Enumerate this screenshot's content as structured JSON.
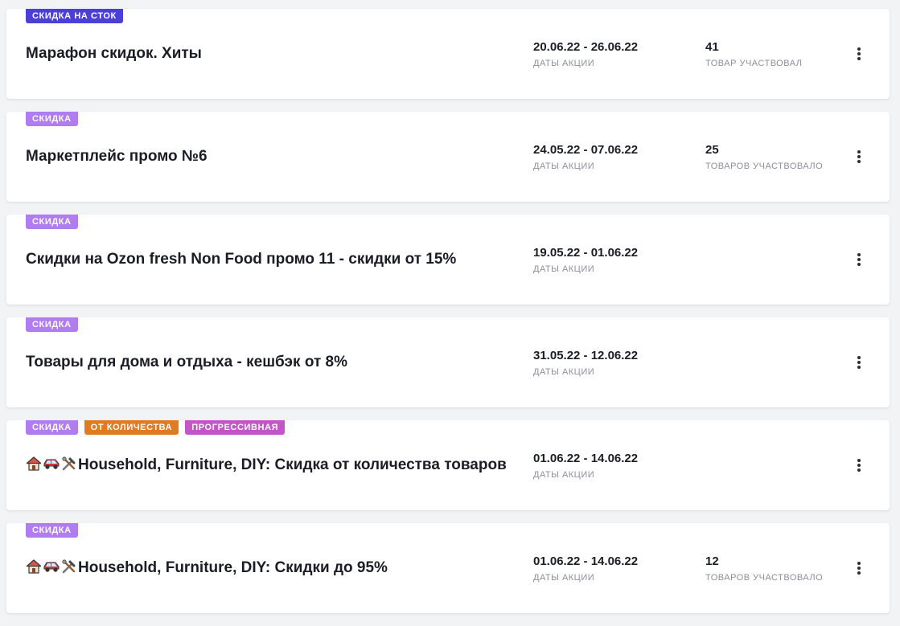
{
  "colors": {
    "stock_badge": "#4b3fd6",
    "discount_badge": "#b17cf0",
    "quantity_badge": "#e07b21",
    "progressive_badge": "#c355c9"
  },
  "promotions": [
    {
      "badges": [
        {
          "label": "СКИДКА НА СТОК",
          "type": "stock"
        }
      ],
      "icons": [],
      "title": "Марафон скидок. Хиты",
      "dates": "20.06.22 - 26.06.22",
      "dates_caption": "ДАТЫ АКЦИИ",
      "count": "41",
      "count_caption": "ТОВАР УЧАСТВОВАЛ"
    },
    {
      "badges": [
        {
          "label": "СКИДКА",
          "type": "discount"
        }
      ],
      "icons": [],
      "title": "Маркетплейс промо №6",
      "dates": "24.05.22 - 07.06.22",
      "dates_caption": "ДАТЫ АКЦИИ",
      "count": "25",
      "count_caption": "ТОВАРОВ УЧАСТВОВАЛО"
    },
    {
      "badges": [
        {
          "label": "СКИДКА",
          "type": "discount"
        }
      ],
      "icons": [],
      "title": "Скидки на Ozon fresh Non Food промо 11 - скидки от 15%",
      "dates": "19.05.22 - 01.06.22",
      "dates_caption": "ДАТЫ АКЦИИ",
      "count": "",
      "count_caption": ""
    },
    {
      "badges": [
        {
          "label": "СКИДКА",
          "type": "discount"
        }
      ],
      "icons": [],
      "title": "Товары для дома и отдыха - кешбэк от 8%",
      "dates": "31.05.22 - 12.06.22",
      "dates_caption": "ДАТЫ АКЦИИ",
      "count": "",
      "count_caption": ""
    },
    {
      "badges": [
        {
          "label": "СКИДКА",
          "type": "discount"
        },
        {
          "label": "ОТ КОЛИЧЕСТВА",
          "type": "quantity"
        },
        {
          "label": "ПРОГРЕССИВНАЯ",
          "type": "progressive"
        }
      ],
      "icons": [
        "house-icon",
        "car-icon",
        "tools-icon"
      ],
      "title": "Household, Furniture, DIY: Скидка от количества товаров",
      "dates": "01.06.22 - 14.06.22",
      "dates_caption": "ДАТЫ АКЦИИ",
      "count": "",
      "count_caption": ""
    },
    {
      "badges": [
        {
          "label": "СКИДКА",
          "type": "discount"
        }
      ],
      "icons": [
        "house-icon",
        "car-icon",
        "tools-icon"
      ],
      "title": "Household, Furniture, DIY: Скидки до 95%",
      "dates": "01.06.22 - 14.06.22",
      "dates_caption": "ДАТЫ АКЦИИ",
      "count": "12",
      "count_caption": "ТОВАРОВ УЧАСТВОВАЛО"
    }
  ]
}
